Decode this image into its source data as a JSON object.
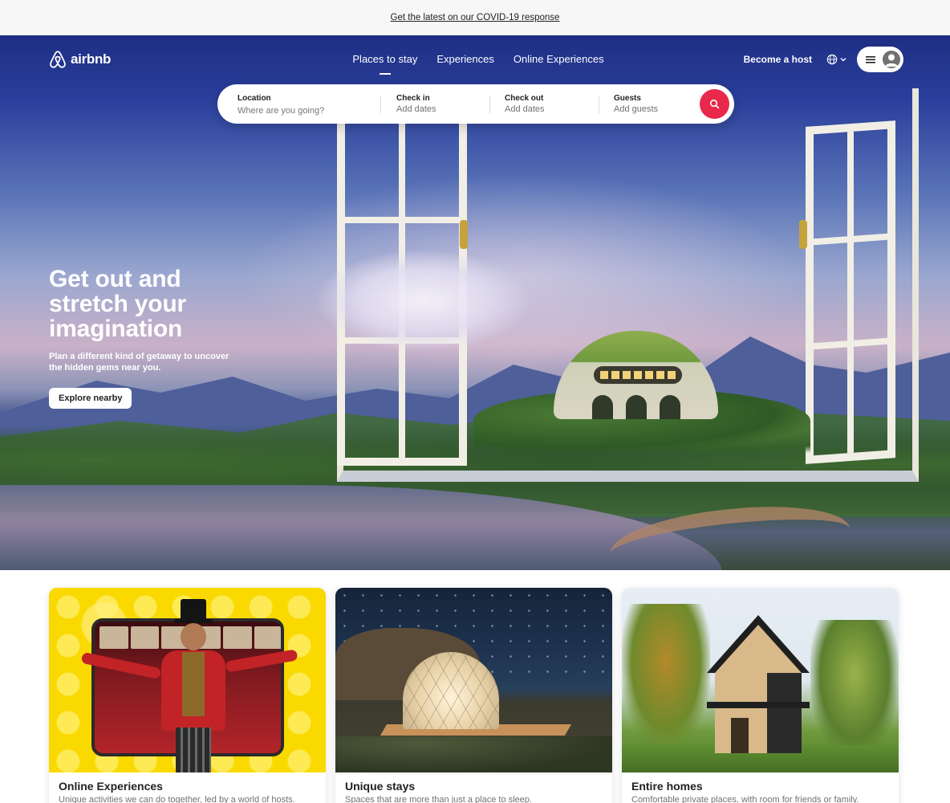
{
  "banner": {
    "link_text": "Get the latest on our COVID-19 response"
  },
  "header": {
    "logo_text": "airbnb",
    "tabs": [
      {
        "label": "Places to stay",
        "active": true
      },
      {
        "label": "Experiences",
        "active": false
      },
      {
        "label": "Online Experiences",
        "active": false
      }
    ],
    "become_host": "Become a host",
    "icons": {
      "language": "globe-icon",
      "menu": "hamburger-icon",
      "profile": "user-avatar-icon"
    }
  },
  "search": {
    "location": {
      "label": "Location",
      "placeholder": "Where are you going?"
    },
    "check_in": {
      "label": "Check in",
      "placeholder": "Add dates"
    },
    "check_out": {
      "label": "Check out",
      "placeholder": "Add dates"
    },
    "guests": {
      "label": "Guests",
      "placeholder": "Add guests"
    },
    "button_icon": "search-icon",
    "button_color": "#e8294b"
  },
  "hero": {
    "title_line1": "Get out and",
    "title_line2": "stretch your",
    "title_line3": "imagination",
    "subtitle": "Plan a different kind of getaway to uncover the hidden gems near you.",
    "cta": "Explore nearby"
  },
  "cards": [
    {
      "title": "Online Experiences",
      "subtitle": "Unique activities we can do together, led by a world of hosts."
    },
    {
      "title": "Unique stays",
      "subtitle": "Spaces that are more than just a place to sleep."
    },
    {
      "title": "Entire homes",
      "subtitle": "Comfortable private places, with room for friends or family."
    }
  ],
  "colors": {
    "brand": "#ff385c",
    "search_button": "#e8294b",
    "text": "#222222",
    "muted": "#717171"
  }
}
